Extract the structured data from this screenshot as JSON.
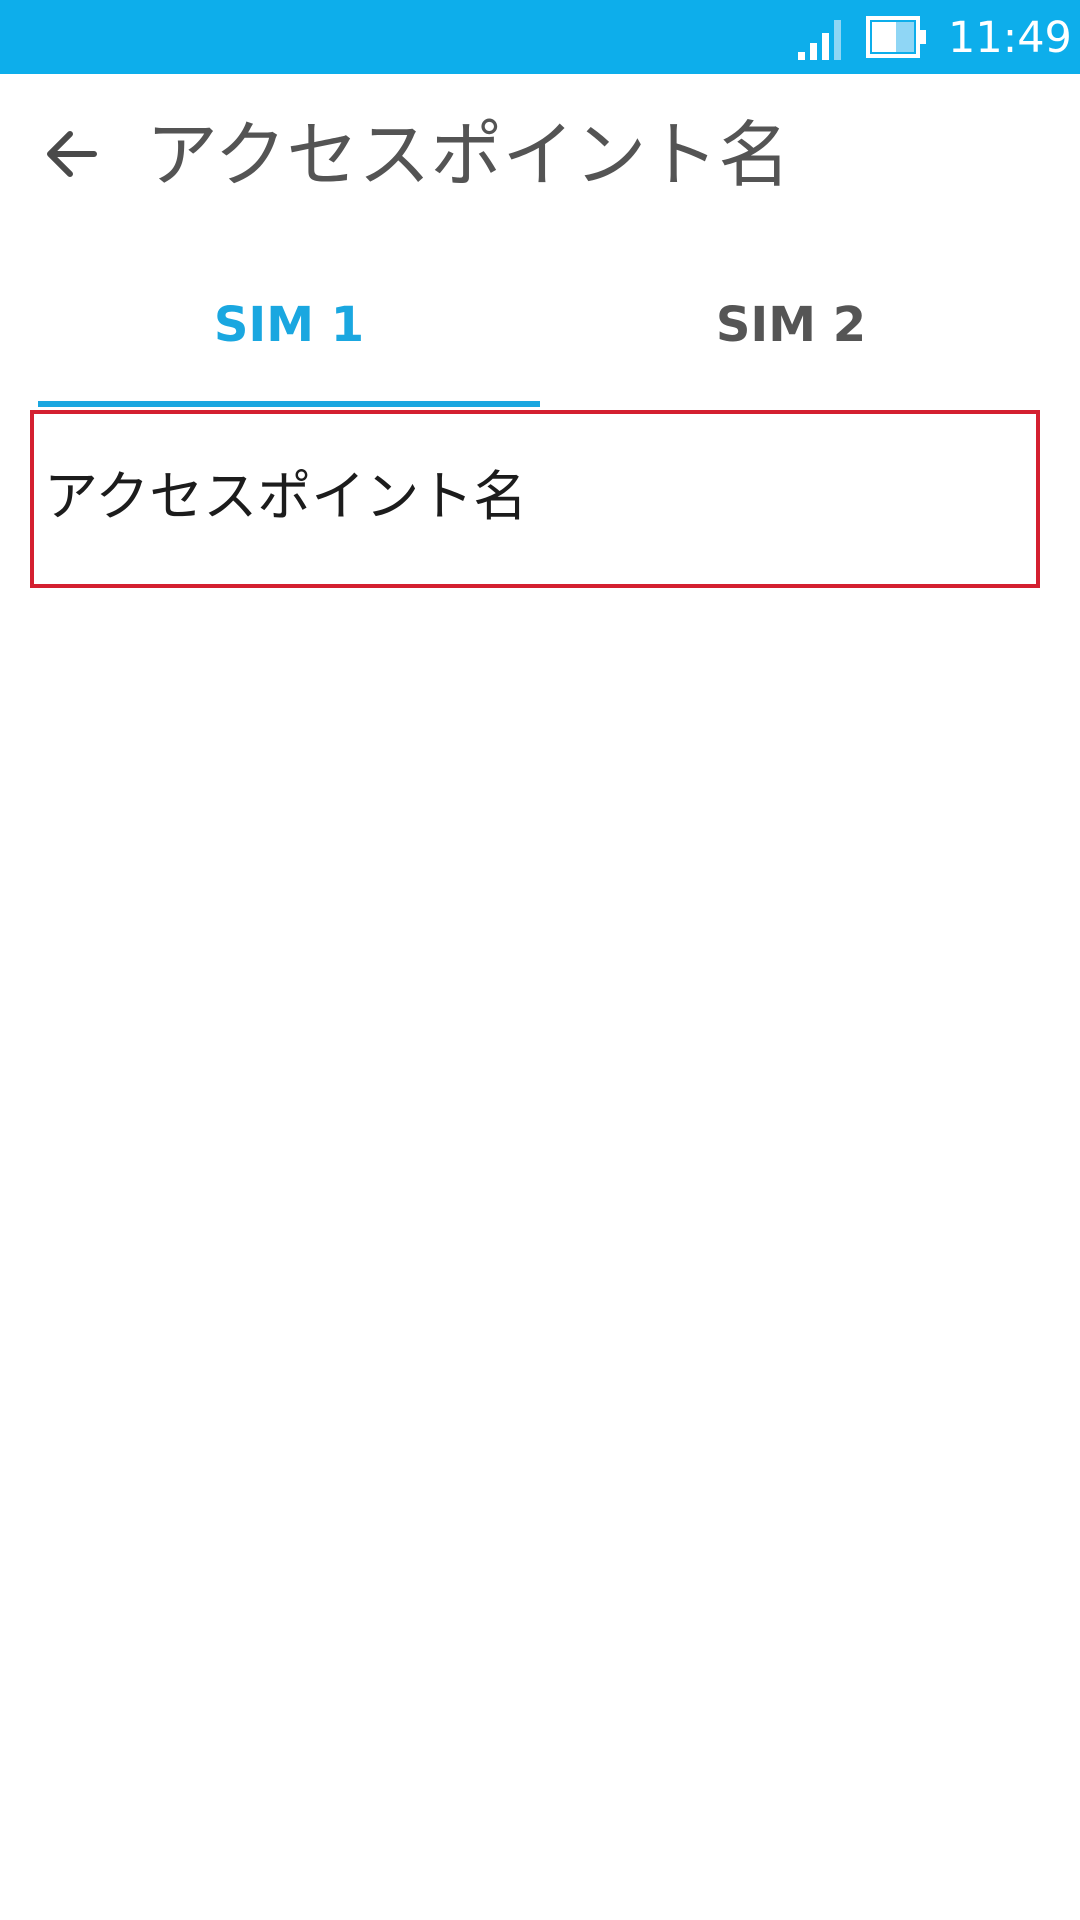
{
  "status_bar": {
    "time": "11:49",
    "signal_icon": "signal-icon",
    "battery_icon": "battery-icon",
    "background_color": "#0daeeb"
  },
  "header": {
    "back_icon": "arrow-left-icon",
    "title": "アクセスポイント名"
  },
  "tabs": [
    {
      "label": "SIM 1",
      "selected": true
    },
    {
      "label": "SIM 2",
      "selected": false
    }
  ],
  "accent_color": "#1aa7e0",
  "list": {
    "items": [
      {
        "label": "アクセスポイント名",
        "highlight_color": "#d42030"
      }
    ]
  }
}
